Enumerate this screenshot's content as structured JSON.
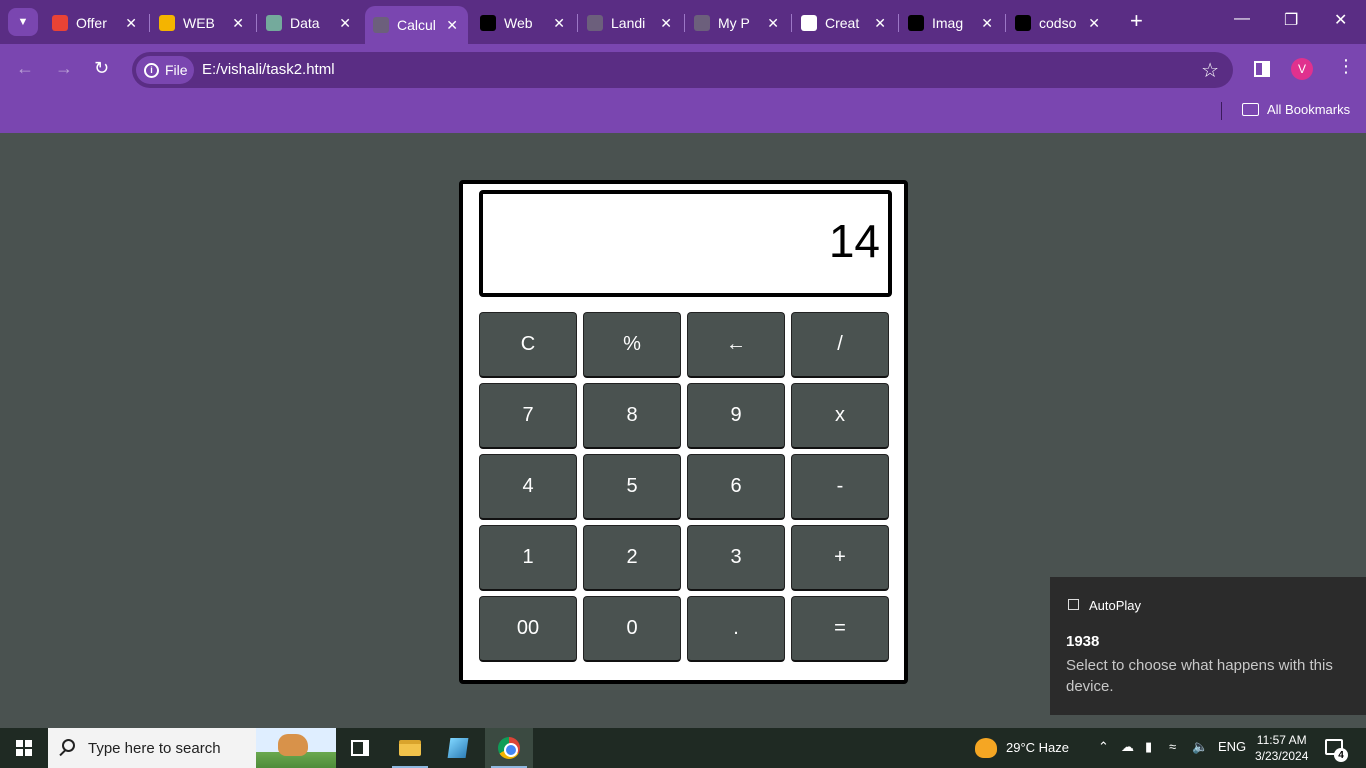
{
  "browser": {
    "tabs": [
      {
        "title": "Offer",
        "icon": "gmail-icon",
        "color": "#ea4335"
      },
      {
        "title": "WEB",
        "icon": "drive-icon",
        "color": "#f4b400"
      },
      {
        "title": "Data",
        "icon": "chatgpt-icon",
        "color": "#74aa9c"
      },
      {
        "title": "Calcul",
        "icon": "globe-icon",
        "color": "#6c5f7c"
      },
      {
        "title": "Web",
        "icon": "webflow-icon",
        "color": "#000000"
      },
      {
        "title": "Landi",
        "icon": "globe-icon",
        "color": "#6c5f7c"
      },
      {
        "title": "My P",
        "icon": "globe-icon",
        "color": "#6c5f7c"
      },
      {
        "title": "Creat",
        "icon": "google-icon",
        "color": "#ffffff"
      },
      {
        "title": "Imag",
        "icon": "m-logo-icon",
        "color": "#000000"
      },
      {
        "title": "codso",
        "icon": "github-icon",
        "color": "#000000"
      }
    ],
    "active_tab_index": 3,
    "address": {
      "chip": "File",
      "url": "E:/vishali/task2.html"
    },
    "profile_initial": "V",
    "bookmarks_label": "All Bookmarks",
    "accent": "#7a46b0"
  },
  "calculator": {
    "display": "14",
    "keys": [
      "C",
      "%",
      "←",
      "/",
      "7",
      "8",
      "9",
      "x",
      "4",
      "5",
      "6",
      "-",
      "1",
      "2",
      "3",
      "+",
      "00",
      "0",
      ".",
      "="
    ]
  },
  "notification": {
    "app": "AutoPlay",
    "title": "1938",
    "body": "Select to choose what happens with this device."
  },
  "taskbar": {
    "search_placeholder": "Type here to search",
    "weather": "29°C  Haze",
    "language": "ENG",
    "time": "11:57 AM",
    "date": "3/23/2024",
    "notification_count": "4"
  }
}
